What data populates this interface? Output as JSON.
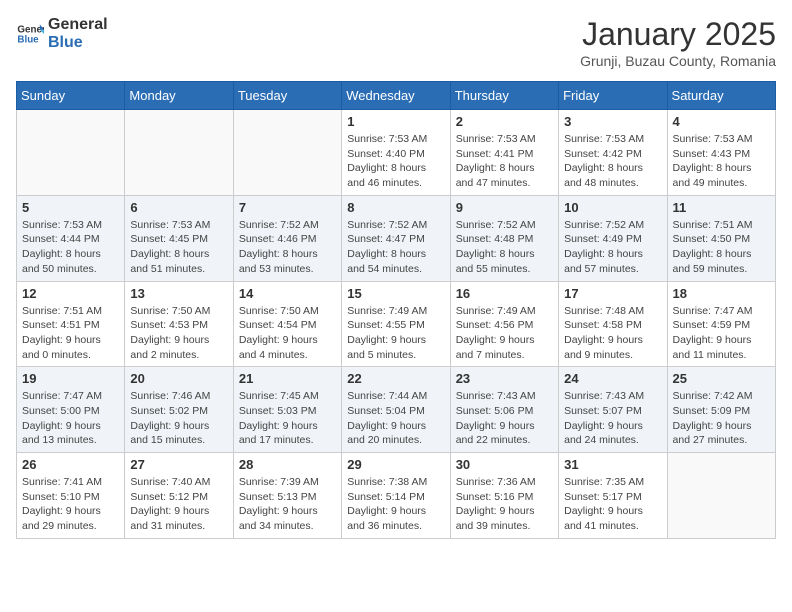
{
  "header": {
    "logo_general": "General",
    "logo_blue": "Blue",
    "title": "January 2025",
    "subtitle": "Grunji, Buzau County, Romania"
  },
  "columns": [
    "Sunday",
    "Monday",
    "Tuesday",
    "Wednesday",
    "Thursday",
    "Friday",
    "Saturday"
  ],
  "weeks": [
    {
      "shaded": false,
      "days": [
        {
          "num": "",
          "detail": ""
        },
        {
          "num": "",
          "detail": ""
        },
        {
          "num": "",
          "detail": ""
        },
        {
          "num": "1",
          "detail": "Sunrise: 7:53 AM\nSunset: 4:40 PM\nDaylight: 8 hours\nand 46 minutes."
        },
        {
          "num": "2",
          "detail": "Sunrise: 7:53 AM\nSunset: 4:41 PM\nDaylight: 8 hours\nand 47 minutes."
        },
        {
          "num": "3",
          "detail": "Sunrise: 7:53 AM\nSunset: 4:42 PM\nDaylight: 8 hours\nand 48 minutes."
        },
        {
          "num": "4",
          "detail": "Sunrise: 7:53 AM\nSunset: 4:43 PM\nDaylight: 8 hours\nand 49 minutes."
        }
      ]
    },
    {
      "shaded": true,
      "days": [
        {
          "num": "5",
          "detail": "Sunrise: 7:53 AM\nSunset: 4:44 PM\nDaylight: 8 hours\nand 50 minutes."
        },
        {
          "num": "6",
          "detail": "Sunrise: 7:53 AM\nSunset: 4:45 PM\nDaylight: 8 hours\nand 51 minutes."
        },
        {
          "num": "7",
          "detail": "Sunrise: 7:52 AM\nSunset: 4:46 PM\nDaylight: 8 hours\nand 53 minutes."
        },
        {
          "num": "8",
          "detail": "Sunrise: 7:52 AM\nSunset: 4:47 PM\nDaylight: 8 hours\nand 54 minutes."
        },
        {
          "num": "9",
          "detail": "Sunrise: 7:52 AM\nSunset: 4:48 PM\nDaylight: 8 hours\nand 55 minutes."
        },
        {
          "num": "10",
          "detail": "Sunrise: 7:52 AM\nSunset: 4:49 PM\nDaylight: 8 hours\nand 57 minutes."
        },
        {
          "num": "11",
          "detail": "Sunrise: 7:51 AM\nSunset: 4:50 PM\nDaylight: 8 hours\nand 59 minutes."
        }
      ]
    },
    {
      "shaded": false,
      "days": [
        {
          "num": "12",
          "detail": "Sunrise: 7:51 AM\nSunset: 4:51 PM\nDaylight: 9 hours\nand 0 minutes."
        },
        {
          "num": "13",
          "detail": "Sunrise: 7:50 AM\nSunset: 4:53 PM\nDaylight: 9 hours\nand 2 minutes."
        },
        {
          "num": "14",
          "detail": "Sunrise: 7:50 AM\nSunset: 4:54 PM\nDaylight: 9 hours\nand 4 minutes."
        },
        {
          "num": "15",
          "detail": "Sunrise: 7:49 AM\nSunset: 4:55 PM\nDaylight: 9 hours\nand 5 minutes."
        },
        {
          "num": "16",
          "detail": "Sunrise: 7:49 AM\nSunset: 4:56 PM\nDaylight: 9 hours\nand 7 minutes."
        },
        {
          "num": "17",
          "detail": "Sunrise: 7:48 AM\nSunset: 4:58 PM\nDaylight: 9 hours\nand 9 minutes."
        },
        {
          "num": "18",
          "detail": "Sunrise: 7:47 AM\nSunset: 4:59 PM\nDaylight: 9 hours\nand 11 minutes."
        }
      ]
    },
    {
      "shaded": true,
      "days": [
        {
          "num": "19",
          "detail": "Sunrise: 7:47 AM\nSunset: 5:00 PM\nDaylight: 9 hours\nand 13 minutes."
        },
        {
          "num": "20",
          "detail": "Sunrise: 7:46 AM\nSunset: 5:02 PM\nDaylight: 9 hours\nand 15 minutes."
        },
        {
          "num": "21",
          "detail": "Sunrise: 7:45 AM\nSunset: 5:03 PM\nDaylight: 9 hours\nand 17 minutes."
        },
        {
          "num": "22",
          "detail": "Sunrise: 7:44 AM\nSunset: 5:04 PM\nDaylight: 9 hours\nand 20 minutes."
        },
        {
          "num": "23",
          "detail": "Sunrise: 7:43 AM\nSunset: 5:06 PM\nDaylight: 9 hours\nand 22 minutes."
        },
        {
          "num": "24",
          "detail": "Sunrise: 7:43 AM\nSunset: 5:07 PM\nDaylight: 9 hours\nand 24 minutes."
        },
        {
          "num": "25",
          "detail": "Sunrise: 7:42 AM\nSunset: 5:09 PM\nDaylight: 9 hours\nand 27 minutes."
        }
      ]
    },
    {
      "shaded": false,
      "days": [
        {
          "num": "26",
          "detail": "Sunrise: 7:41 AM\nSunset: 5:10 PM\nDaylight: 9 hours\nand 29 minutes."
        },
        {
          "num": "27",
          "detail": "Sunrise: 7:40 AM\nSunset: 5:12 PM\nDaylight: 9 hours\nand 31 minutes."
        },
        {
          "num": "28",
          "detail": "Sunrise: 7:39 AM\nSunset: 5:13 PM\nDaylight: 9 hours\nand 34 minutes."
        },
        {
          "num": "29",
          "detail": "Sunrise: 7:38 AM\nSunset: 5:14 PM\nDaylight: 9 hours\nand 36 minutes."
        },
        {
          "num": "30",
          "detail": "Sunrise: 7:36 AM\nSunset: 5:16 PM\nDaylight: 9 hours\nand 39 minutes."
        },
        {
          "num": "31",
          "detail": "Sunrise: 7:35 AM\nSunset: 5:17 PM\nDaylight: 9 hours\nand 41 minutes."
        },
        {
          "num": "",
          "detail": ""
        }
      ]
    }
  ]
}
